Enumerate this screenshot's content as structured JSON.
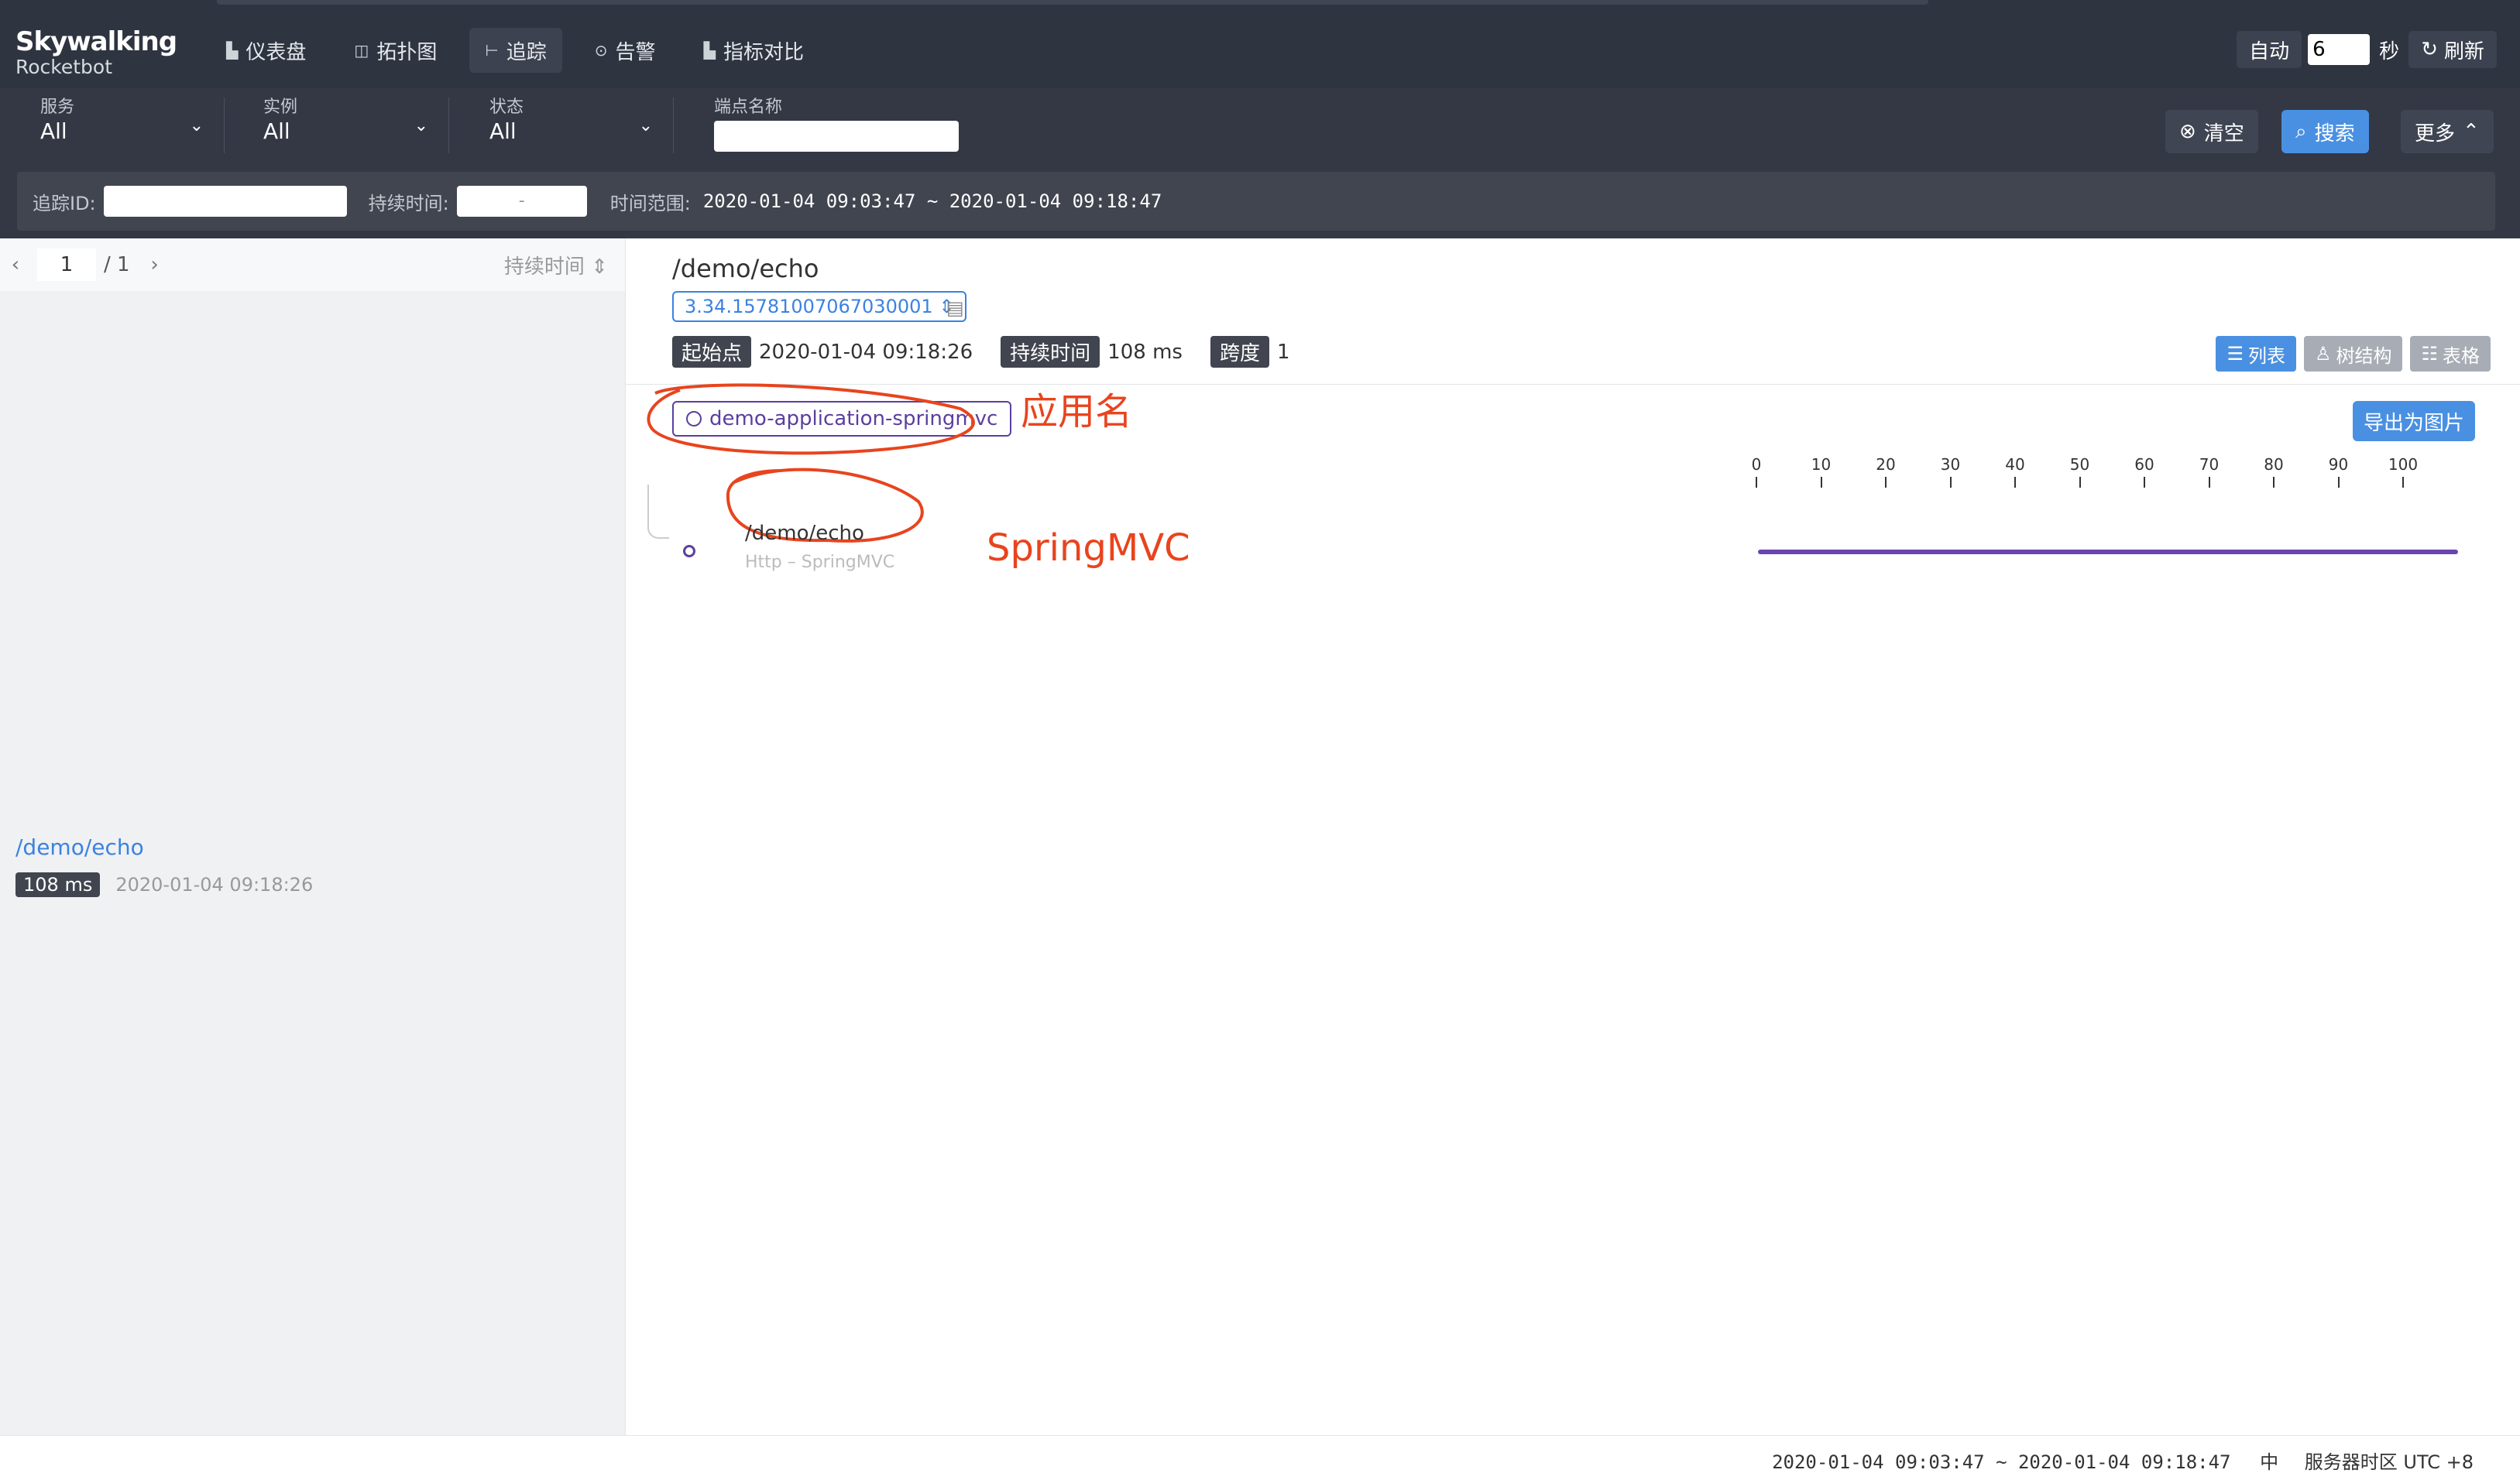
{
  "brand": {
    "logo_line1": "Skywalking",
    "logo_line2": "Rocketbot"
  },
  "nav": [
    {
      "icon": "dashboard-icon",
      "label": "仪表盘"
    },
    {
      "icon": "topology-icon",
      "label": "拓扑图"
    },
    {
      "icon": "trace-icon",
      "label": "追踪"
    },
    {
      "icon": "alarm-icon",
      "label": "告警"
    },
    {
      "icon": "compare-icon",
      "label": "指标对比"
    }
  ],
  "auto_refresh": {
    "auto_label": "自动",
    "interval": "6",
    "unit": "秒",
    "refresh_label": "刷新"
  },
  "filters": {
    "service": {
      "label": "服务",
      "value": "All"
    },
    "instance": {
      "label": "实例",
      "value": "All"
    },
    "status": {
      "label": "状态",
      "value": "All"
    },
    "endpoint": {
      "label": "端点名称",
      "value": ""
    },
    "clear_label": "清空",
    "search_label": "搜索",
    "more_label": "更多",
    "trace_id_label": "追踪ID:",
    "duration_label": "持续时间:",
    "duration_value": "-",
    "time_range_label": "时间范围:",
    "time_range_value": "2020-01-04 09:03:47 ~ 2020-01-04 09:18:47"
  },
  "list": {
    "page": "1",
    "total": "/ 1",
    "sort_label": "持续时间",
    "items": [
      {
        "name": "/demo/echo",
        "duration": "108 ms",
        "time": "2020-01-04 09:18:26"
      }
    ]
  },
  "detail": {
    "title": "/demo/echo",
    "trace_id": "3.34.15781007067030001",
    "start_label": "起始点",
    "start_value": "2020-01-04 09:18:26",
    "duration_label": "持续时间",
    "duration_value": "108 ms",
    "span_label": "跨度",
    "span_value": "1",
    "views": {
      "list": "列表",
      "tree": "树结构",
      "table": "表格"
    },
    "service": "demo-application-springmvc",
    "export_label": "导出为图片",
    "annotation_app": "应用名",
    "annotation_span": "SpringMVC",
    "span": {
      "endpoint": "/demo/echo",
      "sub": "Http – SpringMVC"
    },
    "axis_ticks": [
      "0",
      "10",
      "20",
      "30",
      "40",
      "50",
      "60",
      "70",
      "80",
      "90",
      "100"
    ]
  },
  "footer": {
    "time_range": "2020-01-04 09:03:47 ~ 2020-01-04 09:18:47",
    "lang": "中",
    "timezone": "服务器时区 UTC +8"
  }
}
